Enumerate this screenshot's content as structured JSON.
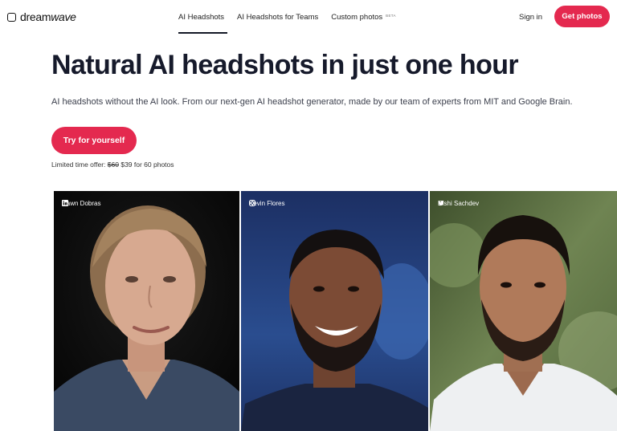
{
  "brand": {
    "name_part1": "dream",
    "name_part2": "wave"
  },
  "nav": {
    "items": [
      {
        "label": "AI Headshots",
        "active": true
      },
      {
        "label": "AI Headshots for Teams",
        "active": false
      },
      {
        "label": "Custom photos",
        "active": false,
        "badge": "BETA"
      }
    ],
    "sign_in": "Sign in",
    "cta": "Get photos"
  },
  "hero": {
    "title": "Natural AI headshots in just one hour",
    "subtitle": "AI headshots without the AI look. From our next-gen AI headshot generator, made by our team of experts from MIT and Google Brain.",
    "button": "Try for yourself",
    "offer_prefix": "Limited time offer:",
    "old_price": "$60",
    "new_price": "$39 for 60 photos"
  },
  "photos": [
    {
      "name": "Dawn Dobras",
      "icon": "linkedin-icon"
    },
    {
      "name": "Kevin Flores",
      "icon": "instagram-icon"
    },
    {
      "name": "Rishi Sachdev",
      "icon": "twitter-icon"
    }
  ],
  "colors": {
    "accent": "#e4294f",
    "text": "#161a2b"
  }
}
